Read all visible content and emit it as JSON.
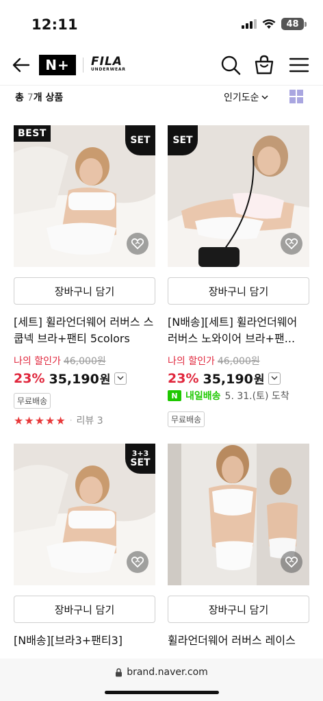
{
  "status": {
    "time": "12:11",
    "battery": "48"
  },
  "header": {
    "logo_np": "N+",
    "brand_main": "FILA",
    "brand_sub": "UNDERWEAR"
  },
  "list": {
    "total_prefix": "총 ",
    "total_num": "7",
    "total_suffix": "개 상품",
    "sort_label": "인기도순"
  },
  "products": [
    {
      "badge": "BEST",
      "set_badge": "SET",
      "cart_label": "장바구니 담기",
      "title": "[세트] 휠라언더웨어 러버스 스쿱넥 브라+팬티 5colors",
      "discount_label": "나의 할인가",
      "original_price": "46,000원",
      "rate": "23%",
      "price": "35,190",
      "unit": "원",
      "shipping": "무료배송",
      "review": "리뷰 3"
    },
    {
      "set_badge": "SET",
      "cart_label": "장바구니 담기",
      "title": "[N배송][세트] 휠라언더웨어 러버스 노와이어 브라+팬...",
      "discount_label": "나의 할인가",
      "original_price": "46,000원",
      "rate": "23%",
      "price": "35,190",
      "unit": "원",
      "delivery_badge": "N",
      "delivery_label": "내일배송",
      "delivery_date": "5. 31.(토) 도착",
      "shipping": "무료배송"
    },
    {
      "set_top": "3+3",
      "set_badge": "SET",
      "cart_label": "장바구니 담기",
      "title": "[N배송][브라3+팬티3]"
    },
    {
      "cart_label": "장바구니 담기",
      "title": "휠라언더웨어 러버스 레이스"
    }
  ],
  "browser": {
    "url": "brand.naver.com"
  }
}
